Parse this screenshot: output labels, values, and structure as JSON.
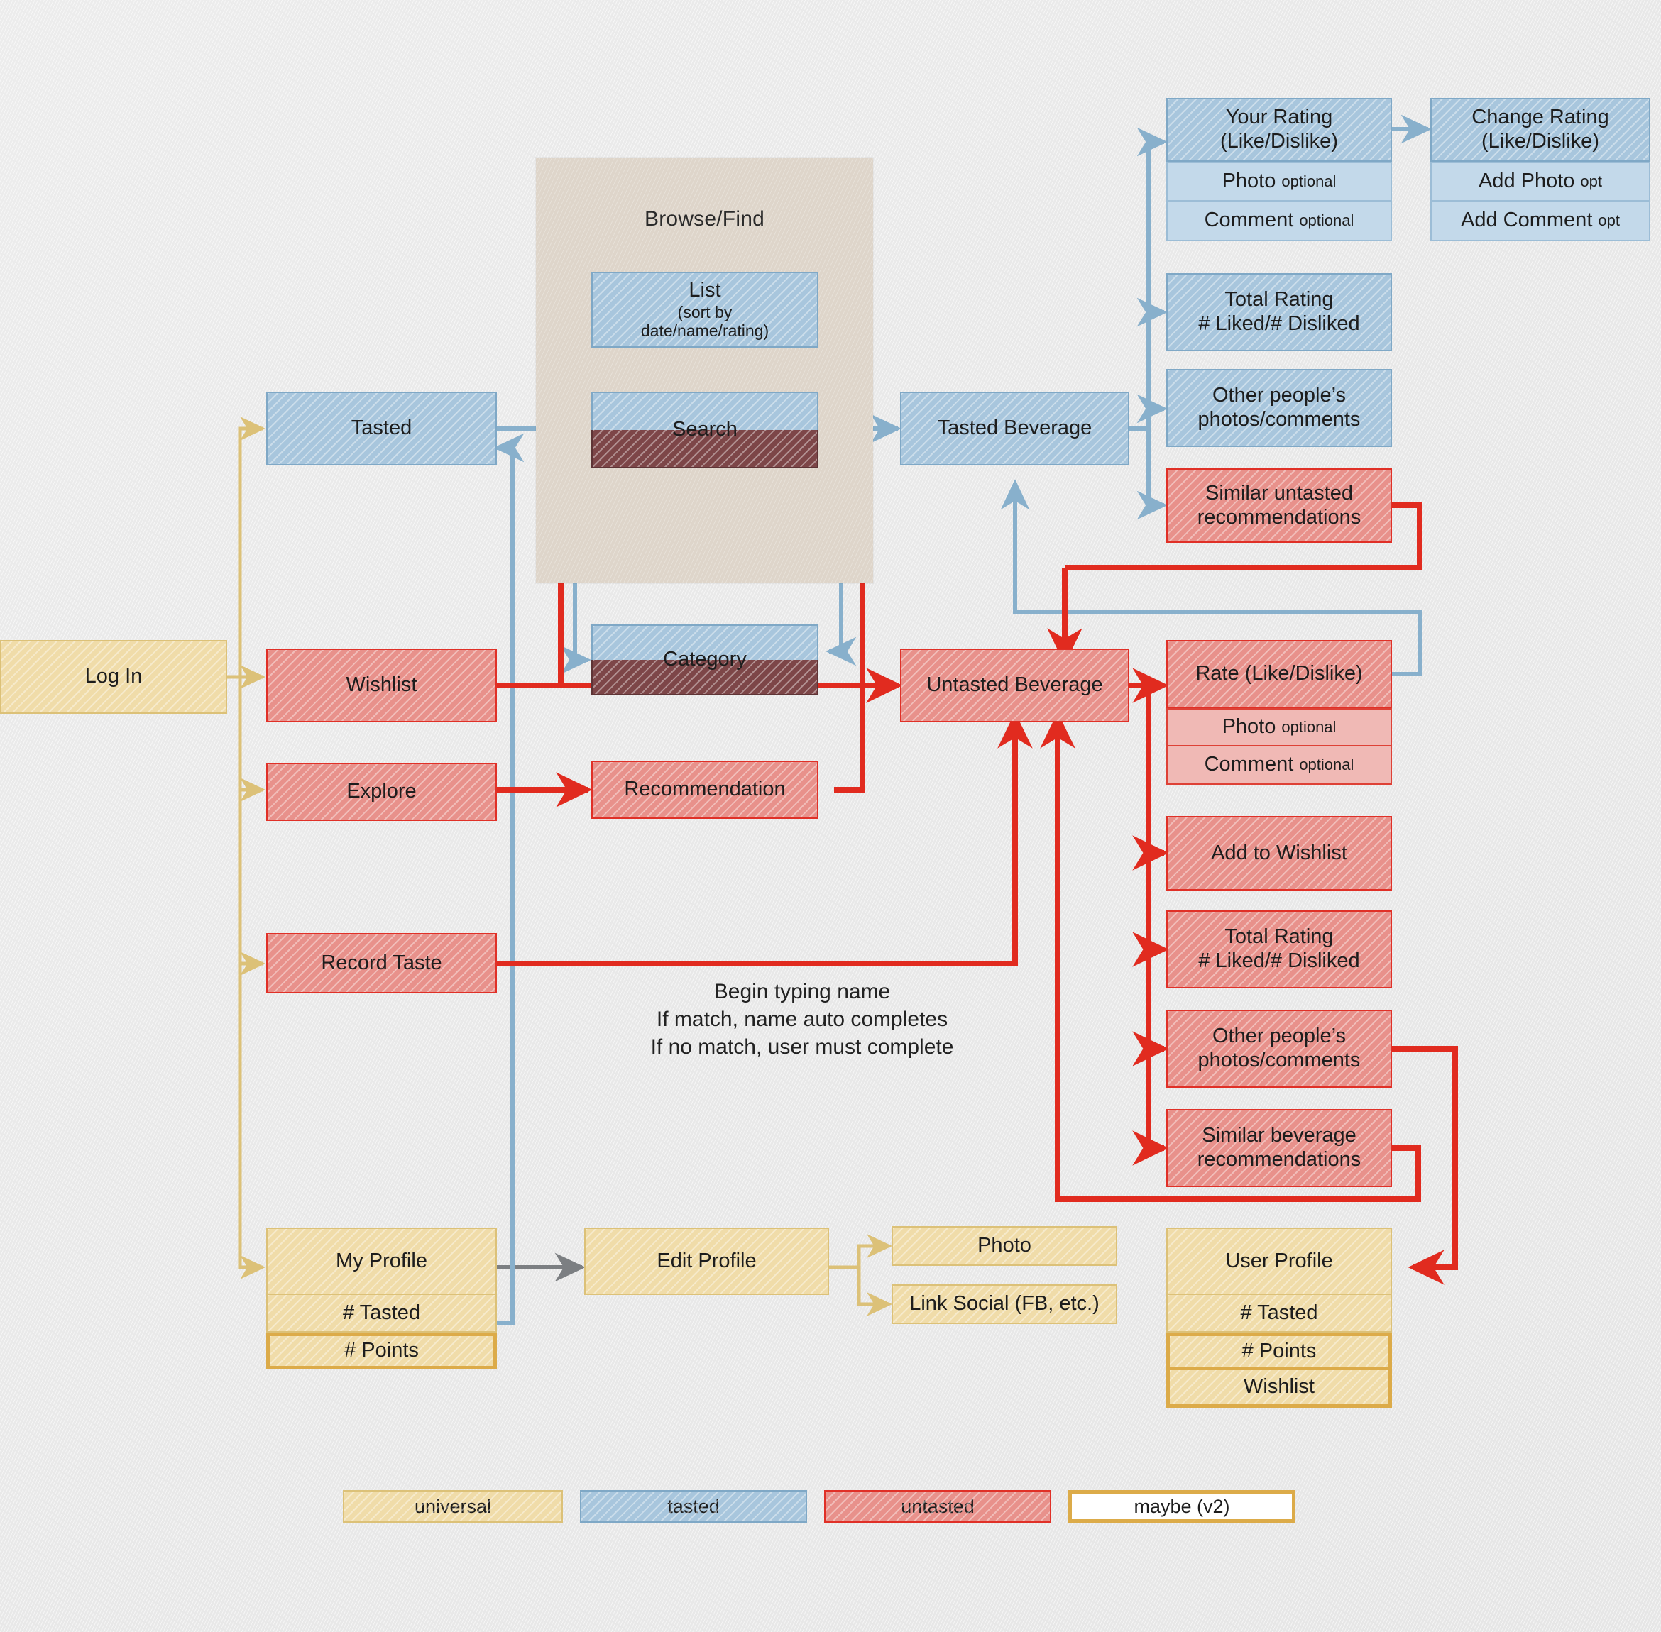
{
  "diagram": {
    "title": "Beverage tasting app user-flow diagram",
    "panel": {
      "label": "Browse/Find"
    },
    "annotation": "Begin typing name\nIf match, name auto completes\nIf no match, user must complete"
  },
  "nodes": {
    "log_in": "Log In",
    "tasted": "Tasted",
    "wishlist": "Wishlist",
    "explore": "Explore",
    "record_taste": "Record Taste",
    "list_title": "List",
    "list_sub": "(sort by",
    "list_sub2": "date/name/rating)",
    "search": "Search",
    "category": "Category",
    "recommendation": "Recommendation",
    "tasted_beverage": "Tasted Beverage",
    "untasted_beverage": "Untasted Beverage",
    "your_rating_l1": "Your Rating",
    "your_rating_l2": "(Like/Dislike)",
    "photo_optional_main": "Photo",
    "photo_optional_tag": "optional",
    "comment_optional_main": "Comment",
    "comment_optional_tag": "optional",
    "change_rating_l1": "Change Rating",
    "change_rating_l2": "(Like/Dislike)",
    "add_photo_main": "Add Photo",
    "add_photo_tag": "opt",
    "add_comment_main": "Add Comment",
    "add_comment_tag": "opt",
    "total_rating_l1": "Total Rating",
    "total_rating_l2": "# Liked/# Disliked",
    "other_people_l1": "Other people’s",
    "other_people_l2": "photos/comments",
    "similar_untasted_l1": "Similar untasted",
    "similar_untasted_l2": "recommendations",
    "rate_like_dislike": "Rate (Like/Dislike)",
    "add_to_wishlist": "Add to Wishlist",
    "similar_beverage_l1": "Similar beverage",
    "similar_beverage_l2": "recommendations",
    "my_profile": "My Profile",
    "num_tasted": "# Tasted",
    "num_points": "# Points",
    "edit_profile": "Edit Profile",
    "photo": "Photo",
    "link_social": "Link Social (FB, etc.)",
    "user_profile": "User Profile",
    "user_num_tasted": "# Tasted",
    "user_num_points": "# Points",
    "user_wishlist": "Wishlist"
  },
  "legend": {
    "items": [
      {
        "label": "universal",
        "style": "lg-gold"
      },
      {
        "label": "tasted",
        "style": "lg-blue"
      },
      {
        "label": "untasted",
        "style": "lg-red"
      },
      {
        "label": "maybe (v2)",
        "style": "lg-v2"
      }
    ]
  },
  "colors": {
    "background": "#eaeaea",
    "panel": "#ded5ca",
    "tasted_fill": "#a8c6dd",
    "tasted_border": "#7fa8c6",
    "untasted_fill": "#e8918b",
    "untasted_border": "#e03027",
    "universal_fill": "#f0dca9",
    "universal_border": "#dcc178",
    "v2_border": "#dcab49",
    "maroon_fill": "#7d4648",
    "gray_arrow": "#7c7f82"
  }
}
